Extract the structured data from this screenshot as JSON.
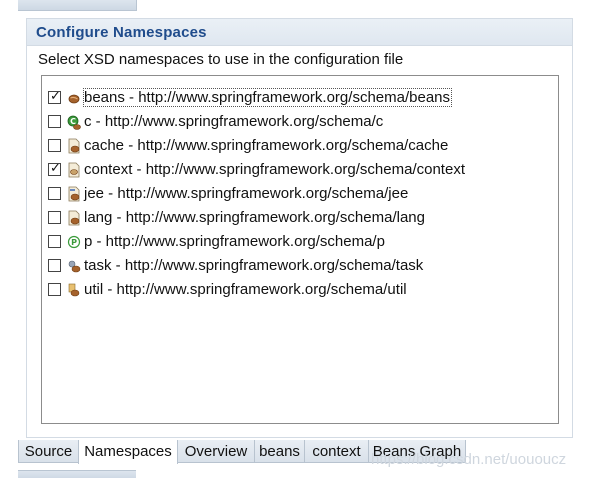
{
  "section": {
    "title": "Configure Namespaces",
    "description": "Select XSD namespaces to use in the configuration file"
  },
  "namespaces": [
    {
      "label": "beans - http://www.springframework.org/schema/beans",
      "checked": true,
      "icon": "bean-icon"
    },
    {
      "label": "c - http://www.springframework.org/schema/c",
      "checked": false,
      "icon": "c-namespace-icon"
    },
    {
      "label": "cache - http://www.springframework.org/schema/cache",
      "checked": false,
      "icon": "cache-icon"
    },
    {
      "label": "context - http://www.springframework.org/schema/context",
      "checked": true,
      "icon": "context-icon"
    },
    {
      "label": "jee - http://www.springframework.org/schema/jee",
      "checked": false,
      "icon": "jee-icon"
    },
    {
      "label": "lang - http://www.springframework.org/schema/lang",
      "checked": false,
      "icon": "lang-icon"
    },
    {
      "label": "p - http://www.springframework.org/schema/p",
      "checked": false,
      "icon": "p-namespace-icon"
    },
    {
      "label": "task - http://www.springframework.org/schema/task",
      "checked": false,
      "icon": "task-icon"
    },
    {
      "label": "util - http://www.springframework.org/schema/util",
      "checked": false,
      "icon": "util-icon"
    }
  ],
  "tabs": [
    {
      "label": "Source",
      "active": false
    },
    {
      "label": "Namespaces",
      "active": true
    },
    {
      "label": "Overview",
      "active": false
    },
    {
      "label": "beans",
      "active": false
    },
    {
      "label": "context",
      "active": false
    },
    {
      "label": "Beans Graph",
      "active": false
    }
  ],
  "watermark": "https://blog.csdn.net/uououcz",
  "colors": {
    "title": "#1f4c8c",
    "header_bg": "#dfe7f0",
    "border": "#d3dbe4"
  }
}
